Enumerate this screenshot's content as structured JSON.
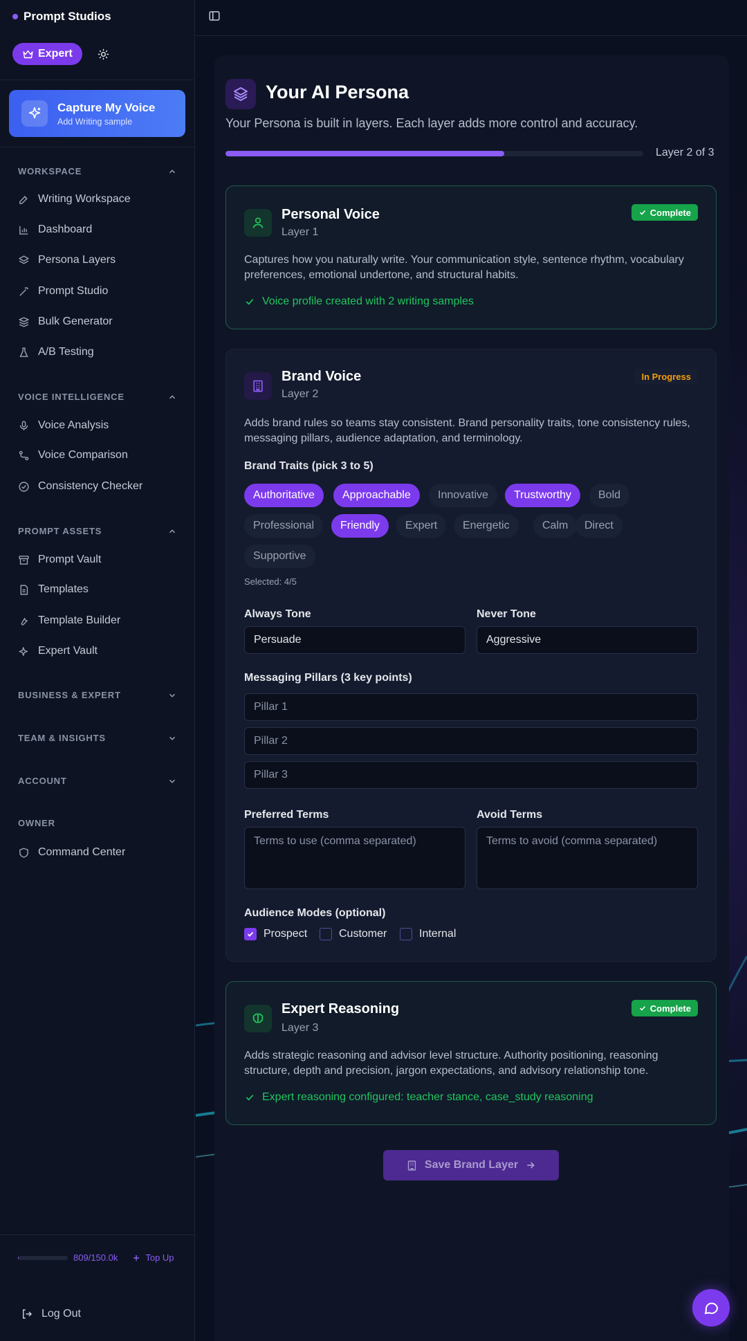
{
  "app": {
    "name": "Prompt Studios",
    "tier": "Expert"
  },
  "capture": {
    "title": "Capture My Voice",
    "subtitle": "Add Writing sample"
  },
  "sidebar": {
    "workspace": {
      "title": "WORKSPACE",
      "items": [
        "Writing Workspace",
        "Dashboard",
        "Persona Layers",
        "Prompt Studio",
        "Bulk Generator",
        "A/B Testing"
      ]
    },
    "voice": {
      "title": "VOICE INTELLIGENCE",
      "items": [
        "Voice Analysis",
        "Voice Comparison",
        "Consistency Checker"
      ]
    },
    "assets": {
      "title": "PROMPT ASSETS",
      "items": [
        "Prompt Vault",
        "Templates",
        "Template Builder",
        "Expert Vault"
      ]
    },
    "business": {
      "title": "BUSINESS & EXPERT"
    },
    "team": {
      "title": "TEAM & INSIGHTS"
    },
    "account": {
      "title": "ACCOUNT"
    },
    "owner": {
      "title": "OWNER",
      "items": [
        "Command Center"
      ]
    },
    "credits": {
      "text": "809/150.0k",
      "used_fraction": 0.0054,
      "topup": "Top Up"
    },
    "logout": "Log Out"
  },
  "page": {
    "title": "Your AI Persona",
    "subtitle": "Your Persona is built in layers. Each layer adds more control and accuracy.",
    "progress": {
      "label": "Layer 2 of 3",
      "percent": 66.7
    }
  },
  "layers": [
    {
      "name": "Personal Voice",
      "layer": "Layer 1",
      "status": "Complete",
      "description": "Captures how you naturally write. Your communication style, sentence rhythm, vocabulary preferences, emotional undertone, and structural habits.",
      "check": "Voice profile created with 2 writing samples"
    },
    {
      "name": "Brand Voice",
      "layer": "Layer 2",
      "status": "In Progress",
      "description": "Adds brand rules so teams stay consistent. Brand personality traits, tone consistency rules, messaging pillars, audience adaptation, and terminology."
    },
    {
      "name": "Expert Reasoning",
      "layer": "Layer 3",
      "status": "Complete",
      "description": "Adds strategic reasoning and advisor level structure. Authority positioning, reasoning structure, depth and precision, jargon expectations, and advisory relationship tone.",
      "check": "Expert reasoning configured: teacher stance, case_study reasoning"
    }
  ],
  "brand": {
    "traits_label": "Brand Traits (pick 3 to 5)",
    "traits": [
      {
        "label": "Authoritative",
        "selected": true
      },
      {
        "label": "Approachable",
        "selected": true
      },
      {
        "label": "Innovative",
        "selected": false
      },
      {
        "label": "Trustworthy",
        "selected": true
      },
      {
        "label": "Bold",
        "selected": false
      },
      {
        "label": "Professional",
        "selected": false
      },
      {
        "label": "Friendly",
        "selected": true
      },
      {
        "label": "Expert",
        "selected": false
      },
      {
        "label": "Energetic",
        "selected": false
      },
      {
        "label": "Calm",
        "selected": false
      },
      {
        "label": "Direct",
        "selected": false
      },
      {
        "label": "Supportive",
        "selected": false
      }
    ],
    "selected_text": "Selected: 4/5",
    "always_tone": {
      "label": "Always Tone",
      "value": "Persuade"
    },
    "never_tone": {
      "label": "Never Tone",
      "value": "Aggressive"
    },
    "pillars": {
      "label": "Messaging Pillars (3 key points)",
      "placeholders": [
        "Pillar 1",
        "Pillar 2",
        "Pillar 3"
      ]
    },
    "preferred": {
      "label": "Preferred Terms",
      "placeholder": "Terms to use (comma separated)"
    },
    "avoid": {
      "label": "Avoid Terms",
      "placeholder": "Terms to avoid (comma separated)"
    },
    "audience": {
      "label": "Audience Modes (optional)",
      "modes": [
        {
          "label": "Prospect",
          "checked": true
        },
        {
          "label": "Customer",
          "checked": false
        },
        {
          "label": "Internal",
          "checked": false
        }
      ]
    }
  },
  "actions": {
    "save": "Save Brand Layer"
  },
  "colors": {
    "accent": "#7c3aed",
    "complete": "#16a34a",
    "in_progress": "#f59e0b",
    "capture": "#3b5ff0"
  },
  "icons": [
    "crown-icon",
    "sun-icon",
    "sparkles-icon",
    "panel-left-icon",
    "layers-icon",
    "user-icon",
    "building-icon",
    "brain-icon",
    "message-circle-icon"
  ]
}
